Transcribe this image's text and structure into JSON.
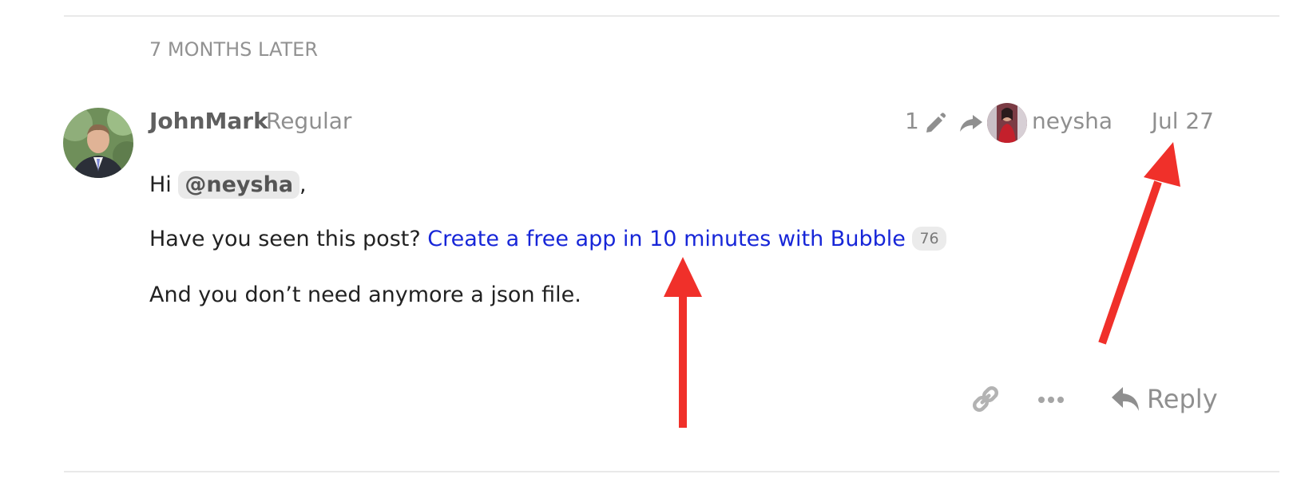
{
  "post": {
    "time_gap": "7 MONTHS LATER",
    "author": {
      "username": "JohnMark",
      "title": "Regular",
      "avatar_icon": "user-avatar-photo"
    },
    "meta": {
      "edit_count": "1",
      "edit_icon": "pencil-icon",
      "share_icon": "share-arrow-icon",
      "reply_to_username": "neysha",
      "date": "Jul 27"
    },
    "body": {
      "greeting": "Hi ",
      "mention": "@neysha",
      "greeting_end": ",",
      "question": "Have you seen this post? ",
      "link_text": "Create a free app in 10 minutes with Bubble",
      "link_clicks": "76",
      "closing": "And you don’t need anymore a json file."
    },
    "actions": {
      "link_icon": "link-icon",
      "more_icon": "more-ellipsis-icon",
      "reply_label": "Reply"
    }
  },
  "colors": {
    "link": "#1726d8",
    "muted": "#8f8f8f",
    "annotation_arrow": "#f0302a"
  }
}
